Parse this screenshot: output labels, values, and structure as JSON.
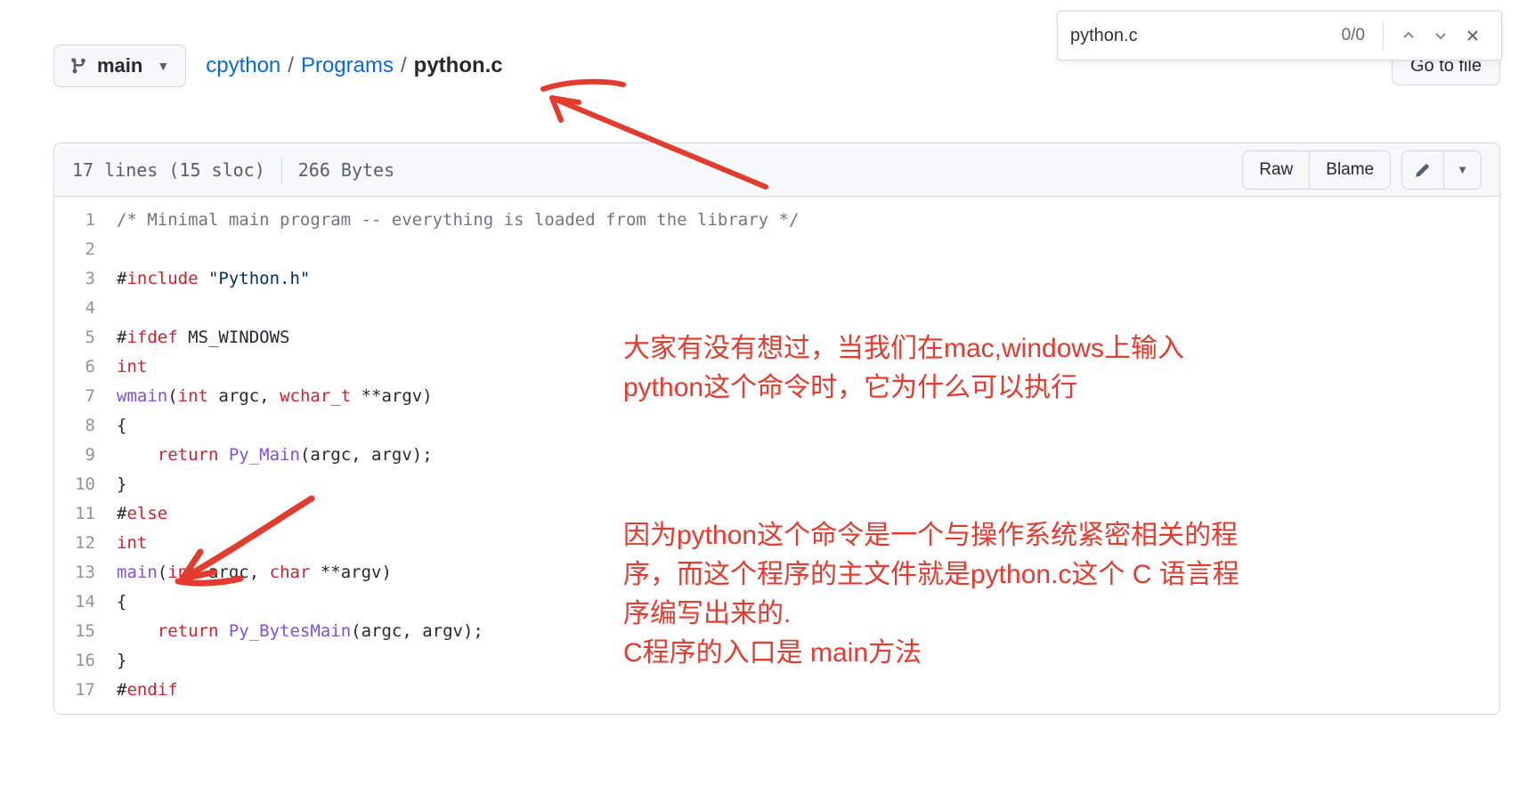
{
  "find": {
    "value": "python.c",
    "count": "0/0"
  },
  "branch": {
    "label": "main"
  },
  "breadcrumb": {
    "root": "cpython",
    "folder": "Programs",
    "file": "python.c"
  },
  "go_to_file": "Go to file",
  "file_info": {
    "lines": "17 lines (15 sloc)",
    "bytes": "266 Bytes"
  },
  "actions": {
    "raw": "Raw",
    "blame": "Blame"
  },
  "code": [
    {
      "n": 1,
      "html": "<span class='c-cmt'>/* Minimal main program -- everything is loaded from the library */</span>"
    },
    {
      "n": 2,
      "html": ""
    },
    {
      "n": 3,
      "html": "#<span class='c-kw'>include</span> <span class='c-str'>\"Python.h\"</span>"
    },
    {
      "n": 4,
      "html": ""
    },
    {
      "n": 5,
      "html": "#<span class='c-kw'>ifdef</span> MS_WINDOWS"
    },
    {
      "n": 6,
      "html": "<span class='c-type'>int</span>"
    },
    {
      "n": 7,
      "html": "<span class='c-fn'>wmain</span>(<span class='c-type'>int</span> argc, <span class='c-type'>wchar_t</span> **argv)"
    },
    {
      "n": 8,
      "html": "{"
    },
    {
      "n": 9,
      "html": "    <span class='c-kw'>return</span> <span class='c-fn'>Py_Main</span>(argc, argv);"
    },
    {
      "n": 10,
      "html": "}"
    },
    {
      "n": 11,
      "html": "#<span class='c-kw'>else</span>"
    },
    {
      "n": 12,
      "html": "<span class='c-type'>int</span>"
    },
    {
      "n": 13,
      "html": "<span class='c-fn'>main</span>(<span class='c-type'>int</span> argc, <span class='c-type'>char</span> **argv)"
    },
    {
      "n": 14,
      "html": "{"
    },
    {
      "n": 15,
      "html": "    <span class='c-kw'>return</span> <span class='c-fn'>Py_BytesMain</span>(argc, argv);"
    },
    {
      "n": 16,
      "html": "}"
    },
    {
      "n": 17,
      "html": "#<span class='c-kw'>endif</span>"
    }
  ],
  "annotations": {
    "p1": "大家有没有想过，当我们在mac,windows上输入 python这个命令时，它为什么可以执行",
    "p2": "因为python这个命令是一个与操作系统紧密相关的程序，而这个程序的主文件就是python.c这个 C 语言程序编写出来的.\nC程序的入口是 main方法"
  }
}
